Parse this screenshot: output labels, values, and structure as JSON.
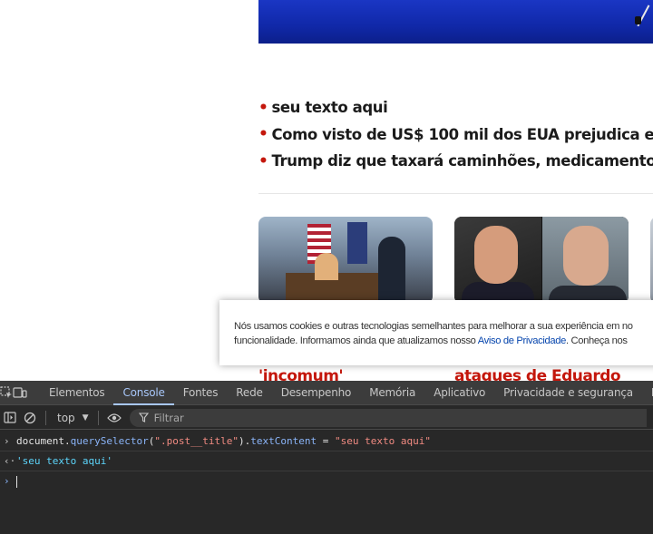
{
  "site": {
    "bullets": [
      "seu texto aqui",
      "Como visto de US$ 100 mil dos EUA prejudica empre",
      "Trump diz que taxará caminhões, medicamentos e m"
    ],
    "cards": [
      {
        "headline": "'incomum'"
      },
      {
        "headline": "ataques de Eduardo"
      }
    ],
    "cookie": {
      "line1": "Nós usamos cookies e outras tecnologias semelhantes para melhorar a sua experiência em no",
      "line2_prefix": "funcionalidade. Informamos ainda que atualizamos nosso ",
      "link": "Aviso de Privacidade",
      "line2_suffix": ". Conheça nos"
    },
    "colors": {
      "accent_red": "#c4170c",
      "link_blue": "#0645ad",
      "hero_blue": "#1a36c4"
    }
  },
  "devtools": {
    "tabs": [
      "Elementos",
      "Console",
      "Fontes",
      "Rede",
      "Desempenho",
      "Memória",
      "Aplicativo",
      "Privacidade e segurança",
      "L"
    ],
    "active_tab": "Console",
    "context": "top",
    "filter_placeholder": "Filtrar",
    "console": {
      "input_obj": "document",
      "input_dot1": ".",
      "input_method": "querySelector",
      "input_paren_open": "(",
      "input_selector": "\".post__title\"",
      "input_paren_close": ").",
      "input_prop": "textContent",
      "input_assign": " = ",
      "input_value": "\"seu texto aqui\"",
      "result": "'seu texto aqui'"
    },
    "colors": {
      "background": "#282828",
      "tab_bar": "#3c3c3c",
      "active_tab": "#a8c7fa"
    }
  }
}
